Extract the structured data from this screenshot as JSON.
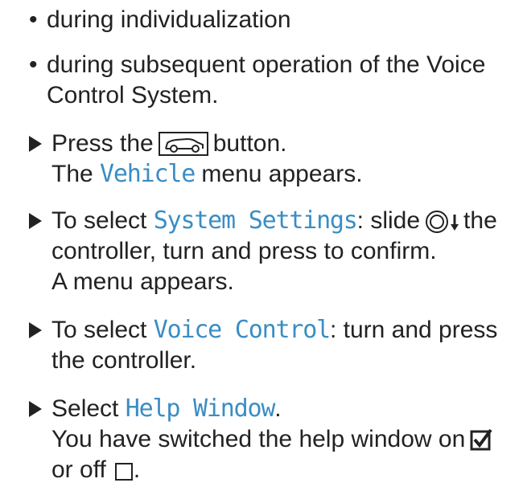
{
  "bullets": [
    "during individualization",
    "during subsequent operation of the Voice",
    "Control System."
  ],
  "step1": {
    "pre": "Press the",
    "icon": "car-vehicle-icon",
    "post": "button.",
    "line2_pre": "The",
    "menu": "Vehicle",
    "line2_post": "menu appears."
  },
  "step2": {
    "pre": "To select",
    "menu": "System Settings",
    "mid": ": slide",
    "icon": "controller-slide-down-icon",
    "post": "the",
    "line2": "controller, turn and press to confirm.",
    "line3": "A menu appears."
  },
  "step3": {
    "pre": "To select",
    "menu": "Voice Control",
    "post": ": turn and press",
    "line2": "the controller."
  },
  "step4": {
    "pre": "Select",
    "menu": "Help Window",
    "post": ".",
    "line2": "You have switched the help window on",
    "icon_on": "checkbox-checked-icon",
    "line3": "or off",
    "icon_off": "checkbox-empty-icon",
    "end": "."
  }
}
